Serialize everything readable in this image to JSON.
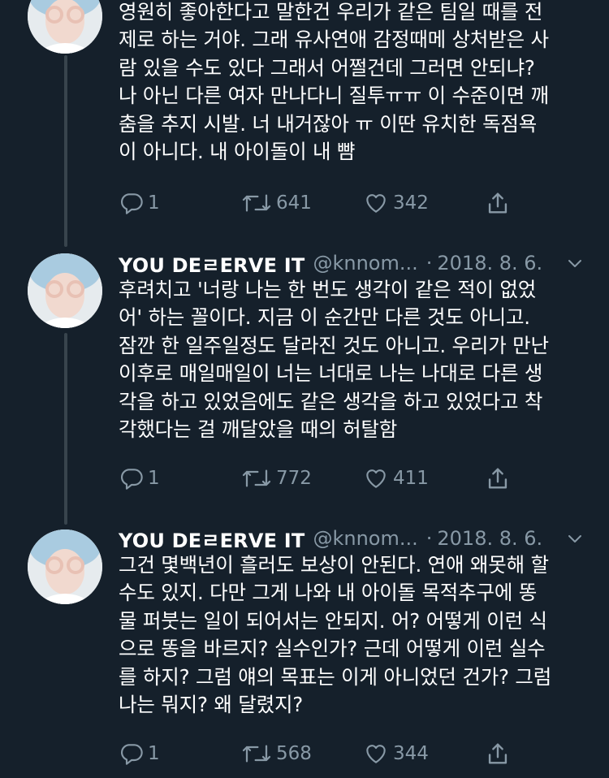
{
  "tweets": [
    {
      "text": "영원히 좋아한다고 말한건 우리가 같은 팀일 때를 전\n제로 하는 거야. 그래 유사연애 감정때메 상처받은 사\n람 있을 수도 있다 그래서 어쩔건데 그러면 안되냐?\n나 아닌 다른 여자 만나다니 질투ㅠㅠ 이 수준이면 깨\n춤을 추지 시발. 너 내거잖아 ㅠ 이딴 유치한 독점욕\n이 아니다. 내 아이돌이 내 뺨",
      "replies": "1",
      "retweets": "641",
      "likes": "342"
    },
    {
      "display_name": "YOU DEㄹERVE IT",
      "handle": "@knnom...",
      "date": "2018. 8. 6.",
      "separator": "·",
      "text": "후려치고 '너랑 나는 한 번도 생각이 같은 적이 없었\n어' 하는 꼴이다. 지금 이 순간만 다른 것도 아니고.\n잠깐 한 일주일정도 달라진 것도 아니고. 우리가 만난\n이후로 매일매일이 너는 너대로 나는 나대로 다른 생\n각을 하고 있었음에도 같은 생각을 하고 있었다고 착\n각했다는 걸 깨달았을 때의 허탈함",
      "replies": "1",
      "retweets": "772",
      "likes": "411"
    },
    {
      "display_name": "YOU DEㄹERVE IT",
      "handle": "@knnom...",
      "date": "2018. 8. 6.",
      "separator": "·",
      "text": "그건 몇백년이 흘러도 보상이 안된다. 연애 왜못해 할\n수도 있지. 다만 그게 나와 내 아이돌 목적추구에 똥\n물 퍼붓는 일이 되어서는 안되지. 어? 어떻게 이런 식\n으로 똥을 바르지? 실수인가? 근데 어떻게 이런 실수\n를 하지? 그럼 얘의 목표는 이게 아니었던 건가? 그럼\n나는 뭐지? 왜 달렸지?",
      "replies": "1",
      "retweets": "568",
      "likes": "344"
    }
  ],
  "colors": {
    "background": "#15202b",
    "text": "#ffffff",
    "muted": "#8899a6",
    "thread_line": "#38444d"
  },
  "icons": {
    "reply": "reply-icon",
    "retweet": "retweet-icon",
    "like": "heart-icon",
    "share": "share-icon",
    "more": "chevron-down-icon"
  }
}
